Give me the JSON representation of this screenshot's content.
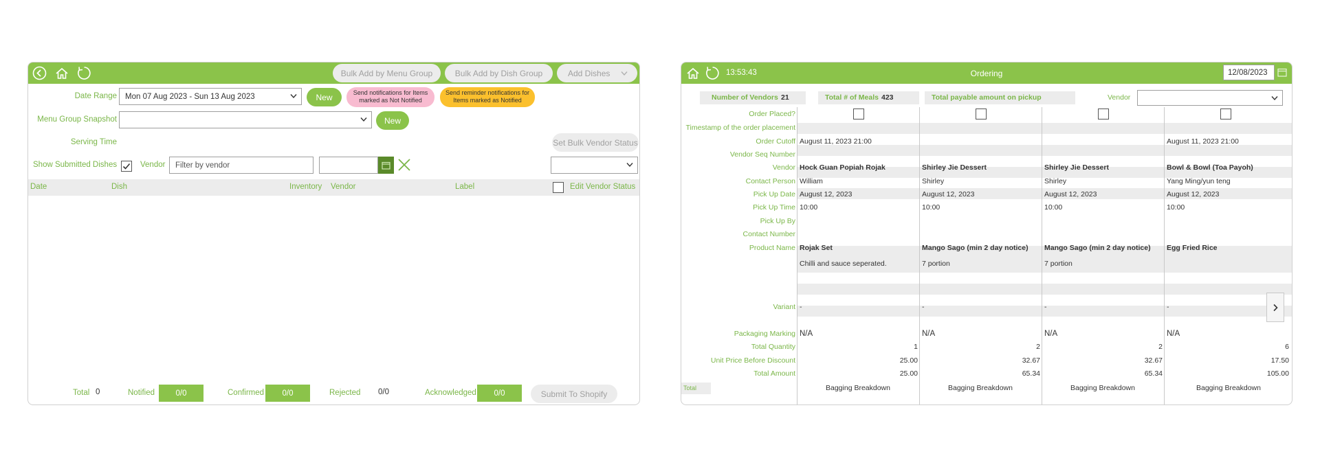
{
  "left": {
    "toolbar": {
      "back_icon": "back-icon",
      "home_icon": "home-icon",
      "refresh_icon": "refresh-icon",
      "bulk_menu_group": "Bulk Add by Menu Group",
      "bulk_dish_group": "Bulk Add by Dish Group",
      "add_dishes": "Add Dishes"
    },
    "filters": {
      "date_range_label": "Date Range",
      "date_range_value": "Mon 07 Aug 2023 - Sun 13 Aug 2023",
      "new_label": "New",
      "notify_not_notified": "Send notifications for Items marked as Not Notified",
      "reminder_notified": "Send reminder notifications for Items marked as Notified",
      "menu_group_label": "Menu Group Snapshot",
      "menu_group_value": "",
      "serving_time_label": "Serving Time",
      "set_bulk_vendor_status": "Set Bulk Vendor Status",
      "show_submitted_label": "Show Submitted Dishes",
      "vendor_label": "Vendor",
      "vendor_placeholder": "Filter by vendor"
    },
    "table_headers": {
      "date": "Date",
      "dish": "Dish",
      "inventory": "Inventory",
      "vendor": "Vendor",
      "label": "Label",
      "edit_vendor_status": "Edit Vendor Status"
    },
    "footer": {
      "total_label": "Total",
      "total_value": "0",
      "notified_label": "Notified",
      "notified_value": "0/0",
      "confirmed_label": "Confirmed",
      "confirmed_value": "0/0",
      "rejected_label": "Rejected",
      "rejected_value": "0/0",
      "acknowledged_label": "Acknowledged",
      "acknowledged_value": "0/0",
      "submit_label": "Submit To Shopify"
    }
  },
  "right": {
    "header": {
      "time": "13:53:43",
      "title": "Ordering",
      "date": "12/08/2023"
    },
    "summary": {
      "vendors_label": "Number of Vendors",
      "vendors_value": "21",
      "meals_label": "Total # of Meals",
      "meals_value": "423",
      "payable_label": "Total payable amount on pickup",
      "payable_value": "",
      "vendor_label": "Vendor"
    },
    "row_labels": {
      "order_placed": "Order Placed?",
      "timestamp": "Timestamp of the order placement",
      "order_cutoff": "Order Cutoff",
      "vendor_seq": "Vendor Seq Number",
      "vendor": "Vendor",
      "contact_person": "Contact Person",
      "pickup_date": "Pick Up Date",
      "pickup_time": "Pick Up Time",
      "pickup_by": "Pick Up By",
      "contact_number": "Contact Number",
      "product_name": "Product Name",
      "variant": "Variant",
      "packaging": "Packaging Marking",
      "total_qty": "Total Quantity",
      "unit_price": "Unit Price Before Discount",
      "total_amount": "Total Amount",
      "total_footer": "Total"
    },
    "columns": [
      {
        "cutoff": "August 11, 2023 21:00",
        "vendor": "Hock Guan Popiah Rojak",
        "contact": "William",
        "pickup_date": "August 12, 2023",
        "pickup_time": "10:00",
        "product": "Rojak Set",
        "note": "Chilli and sauce seperated.",
        "variant": "-",
        "packaging": "N/A",
        "qty": "1",
        "unit_price": "25.00",
        "total": "25.00",
        "bagging": "Bagging Breakdown"
      },
      {
        "cutoff": "",
        "vendor": "Shirley Jie Dessert",
        "contact": "Shirley",
        "pickup_date": "August 12, 2023",
        "pickup_time": "10:00",
        "product": "Mango Sago (min 2 day notice)",
        "note": "7 portion",
        "variant": "-",
        "packaging": "N/A",
        "qty": "2",
        "unit_price": "32.67",
        "total": "65.34",
        "bagging": "Bagging Breakdown"
      },
      {
        "cutoff": "",
        "vendor": "Shirley Jie Dessert",
        "contact": "Shirley",
        "pickup_date": "August 12, 2023",
        "pickup_time": "10:00",
        "product": "Mango Sago (min 2 day notice)",
        "note": "7 portion",
        "variant": "-",
        "packaging": "N/A",
        "qty": "2",
        "unit_price": "32.67",
        "total": "65.34",
        "bagging": "Bagging Breakdown"
      },
      {
        "cutoff": "August 11, 2023 21:00",
        "vendor": "Bowl & Bowl (Toa Payoh)",
        "contact": "Yang Ming/yun teng",
        "pickup_date": "August 12, 2023",
        "pickup_time": "10:00",
        "product": "Egg Fried Rice",
        "note": "",
        "variant": "-",
        "packaging": "N/A",
        "qty": "6",
        "unit_price": "17.50",
        "total": "105.00",
        "bagging": "Bagging Breakdown"
      }
    ]
  },
  "colors": {
    "brand_green": "#8bc34a",
    "label_green": "#7ab648",
    "pink": "#f8bbd0",
    "amber": "#fbc02d"
  }
}
